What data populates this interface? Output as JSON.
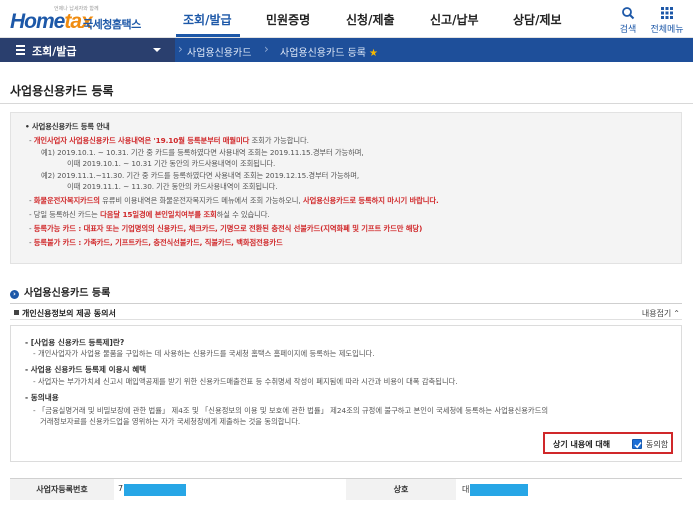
{
  "brand": {
    "tagline": "언제나 납세자와 함께",
    "logo_text_a": "Home",
    "logo_text_b": "tax",
    "name": "국세청홈택스",
    "colors": {
      "primary": "#1d58a8",
      "accent": "#f08c10",
      "crumb_bg": "#1e4f9a",
      "menu_bg": "#2a3f6e",
      "alert": "#d0282a",
      "mask": "#27a6e6"
    }
  },
  "nav": {
    "items": [
      "조회/발급",
      "민원증명",
      "신청/제출",
      "신고/납부",
      "상담/제보"
    ],
    "active_index": 0
  },
  "tools": {
    "search": {
      "label": "검색",
      "icon": "search-icon"
    },
    "menu": {
      "label": "전체메뉴",
      "icon": "grid-menu-icon"
    }
  },
  "crumbbar": {
    "menu_label": "조회/발급",
    "crumb1": "사업용신용카드",
    "crumb2": "사업용신용카드 등록",
    "star": "★"
  },
  "page": {
    "title": "사업용신용카드 등록"
  },
  "info": {
    "heading": "사업용신용카드 등록 안내",
    "l1a": "개인사업자 사업용신용카드 사용내역은 '19.10월 등록분부터 매월미다",
    "l1b": " 조회가 가능합니다.",
    "l2": "예1) 2019.10.1. ~ 10.31. 기간 중 카드를 등록하였다면 사용내역 조회는 2019.11.15.경부터 가능하며,",
    "l3": "이때 2019.10.1. ~ 10.31 기간 동안의 카드사용내역이 조회됩니다.",
    "l4": "예2) 2019.11.1.~11.30. 기간 중 카드를 등록하였다면 사용내역 조회는 2019.12.15.경부터 가능하며,",
    "l5": "이때 2019.11.1. ~ 11.30. 기간 동안의 카드사용내역이 조회됩니다.",
    "l6a": "화물운전자복지카드의",
    "l6b": " 유류비 이용내역은 화물운전자복지카드 메뉴에서 조회 가능하오니,",
    "l6c": " 사업용신용카드로 등록하지 마시기 바랍니다.",
    "l7a": "당일 등록하신 카드는",
    "l7b": " 다음달 15일경에 본인일치여부를 조회",
    "l7c": "하실 수 있습니다.",
    "l8": "등록가능 카드 : 대표자 또는 기업명의의 신용카드, 체크카드, 기명으로 전환된 충전식 선불카드(지역화폐 및 기프트 카드만 해당)",
    "l9": "등록불가 카드 : 가족카드, 기프트카드, 충전식선불카드, 직불카드, 백화점전용카드"
  },
  "section": {
    "title": "사업용신용카드 등록",
    "icon": "info-dot-icon"
  },
  "consent": {
    "title": "개인신용정보의 제공 동의서",
    "fold_label": "내용접기",
    "fold_icon": "chevron-up-icon",
    "q1": "[사업용 신용카드 등록제]란?",
    "a1": "개인사업자가 사업용 물품을 구입하는 데 사용하는 신용카드를 국세청 홈택스 홈페이지에 등록하는 제도입니다.",
    "q2": "사업용 신용카드 등록제 이용시 혜택",
    "a2": "사업자는 부가가치세 신고시 매입액공제를 받기 위한 신용카드매출전표 등 수취명세 작성이 폐지됨에 따라 시간과 비용이 대폭 감축됩니다.",
    "q3": "동의내용",
    "a3a": "「금융실명거래 및 비밀보장에 관한 법률」 제4조 및 「신용정보의 이용 및 보호에 관한 법률」 제24조의 규정에 불구하고 본인이 국세청에 등록하는 사업용신용카드의",
    "a3b": "거래정보자료를 신용카드업을 영위하는 자가 국세청장에게 제출하는 것을 동의합니다.",
    "agree_label": "상기 내용에 대해",
    "agree_checkbox_label": "동의함",
    "agreed": true
  },
  "bottom": {
    "bizno_label": "사업자등록번호",
    "bizno_value_prefix": "7",
    "shop_label": "상호",
    "shop_value_prefix": "대"
  }
}
